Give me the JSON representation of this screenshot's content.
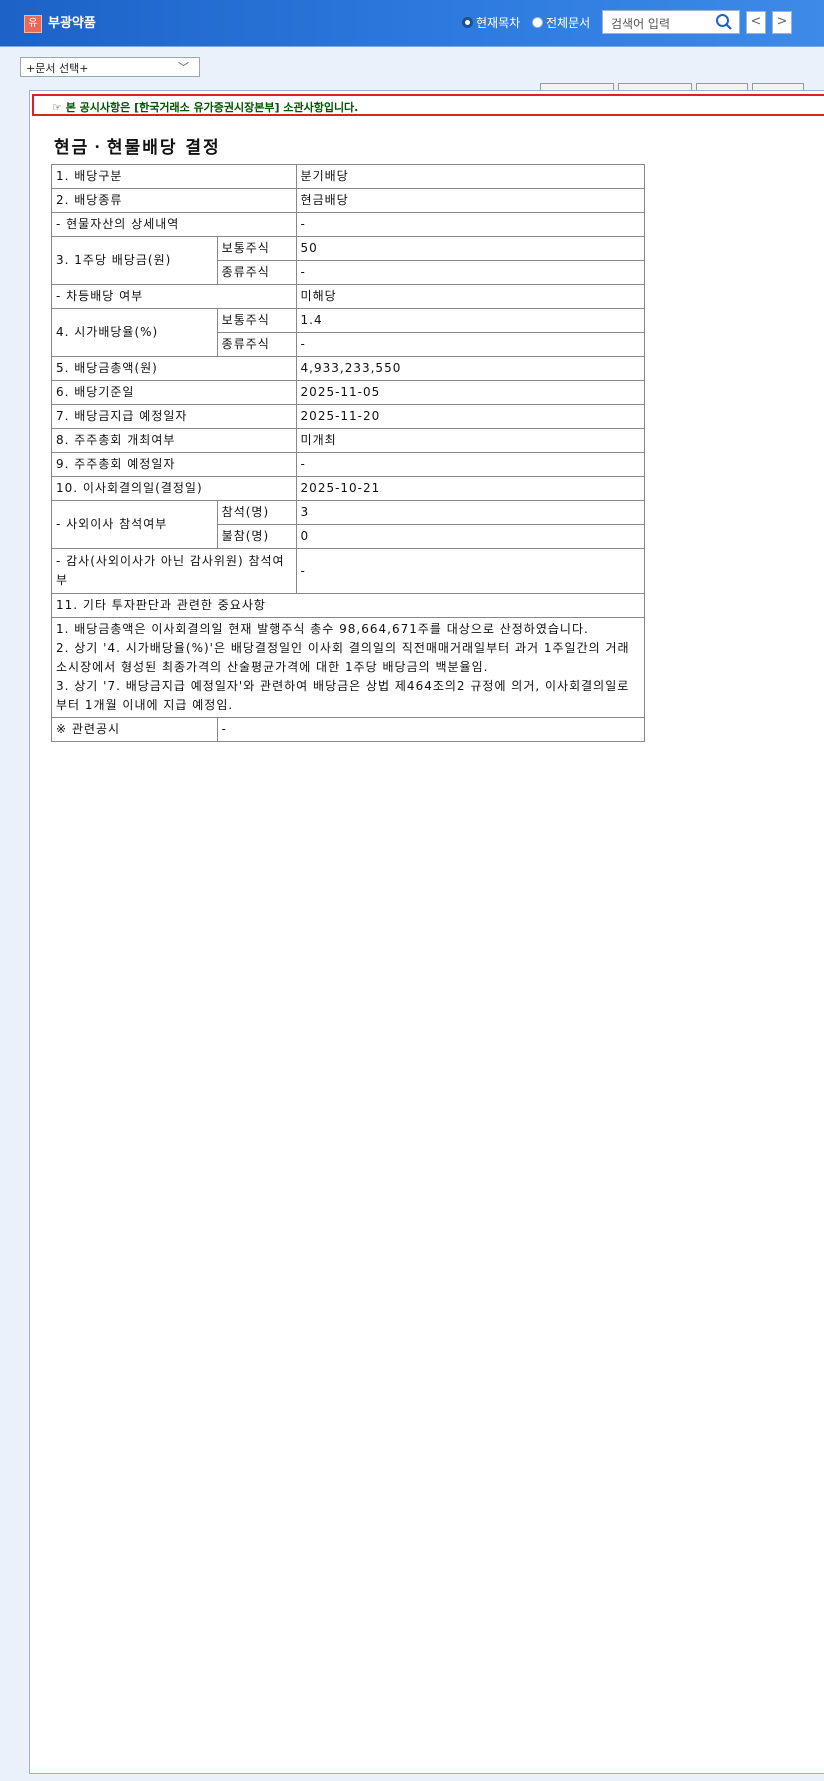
{
  "header": {
    "logo": "유",
    "company": "부광약품",
    "radio_current": "현재목차",
    "radio_all": "전체문서",
    "search_placeholder": "검색어 입력",
    "prev": "<",
    "next": ">"
  },
  "doc_select": "+문서 선택+",
  "notice": "☞ 본 공시사항은 [한국거래소 유가증권시장본부] 소관사항입니다.",
  "title": "현금ㆍ현물배당 결정",
  "rows": {
    "r1": {
      "label": "1. 배당구분",
      "value": "분기배당"
    },
    "r2": {
      "label": "2. 배당종류",
      "value": "현금배당"
    },
    "r2a": {
      "label": "- 현물자산의 상세내역",
      "value": "-"
    },
    "r3": {
      "label": "3. 1주당 배당금(원)",
      "sub1": "보통주식",
      "val1": "50",
      "sub2": "종류주식",
      "val2": "-"
    },
    "r3a": {
      "label": "- 차등배당 여부",
      "value": "미해당"
    },
    "r4": {
      "label": "4. 시가배당율(%)",
      "sub1": "보통주식",
      "val1": "1.4",
      "sub2": "종류주식",
      "val2": "-"
    },
    "r5": {
      "label": "5. 배당금총액(원)",
      "value": "4,933,233,550"
    },
    "r6": {
      "label": "6. 배당기준일",
      "value": "2025-11-05"
    },
    "r7": {
      "label": "7. 배당금지급 예정일자",
      "value": "2025-11-20"
    },
    "r8": {
      "label": "8. 주주총회 개최여부",
      "value": "미개최"
    },
    "r9": {
      "label": "9. 주주총회 예정일자",
      "value": "-"
    },
    "r10": {
      "label": "10. 이사회결의일(결정일)",
      "value": "2025-10-21"
    },
    "r10a": {
      "label": "- 사외이사 참석여부",
      "sub1": "참석(명)",
      "val1": "3",
      "sub2": "불참(명)",
      "val2": "0"
    },
    "r10b": {
      "label": "- 감사(사외이사가 아닌 감사위원) 참석여부",
      "value": "-"
    },
    "r11": {
      "label": "11. 기타 투자판단과 관련한 중요사항"
    },
    "r11_notes": [
      "1. 배당금총액은 이사회결의일 현재 발행주식 총수 98,664,671주를 대상으로 산정하였습니다.",
      "2. 상기 '4. 시가배당율(%)'은 배당결정일인 이사회 결의일의 직전매매거래일부터 과거 1주일간의 거래소시장에서 형성된 최종가격의 산술평균가격에 대한 1주당 배당금의 백분율임.",
      "3. 상기 '7. 배당금지급 예정일자'와 관련하여 배당금은 상법 제464조의2 규정에 의거, 이사회결의일로부터 1개월 이내에 지급 예정임."
    ],
    "related": {
      "label": "※ 관련공시",
      "value": "-"
    }
  }
}
